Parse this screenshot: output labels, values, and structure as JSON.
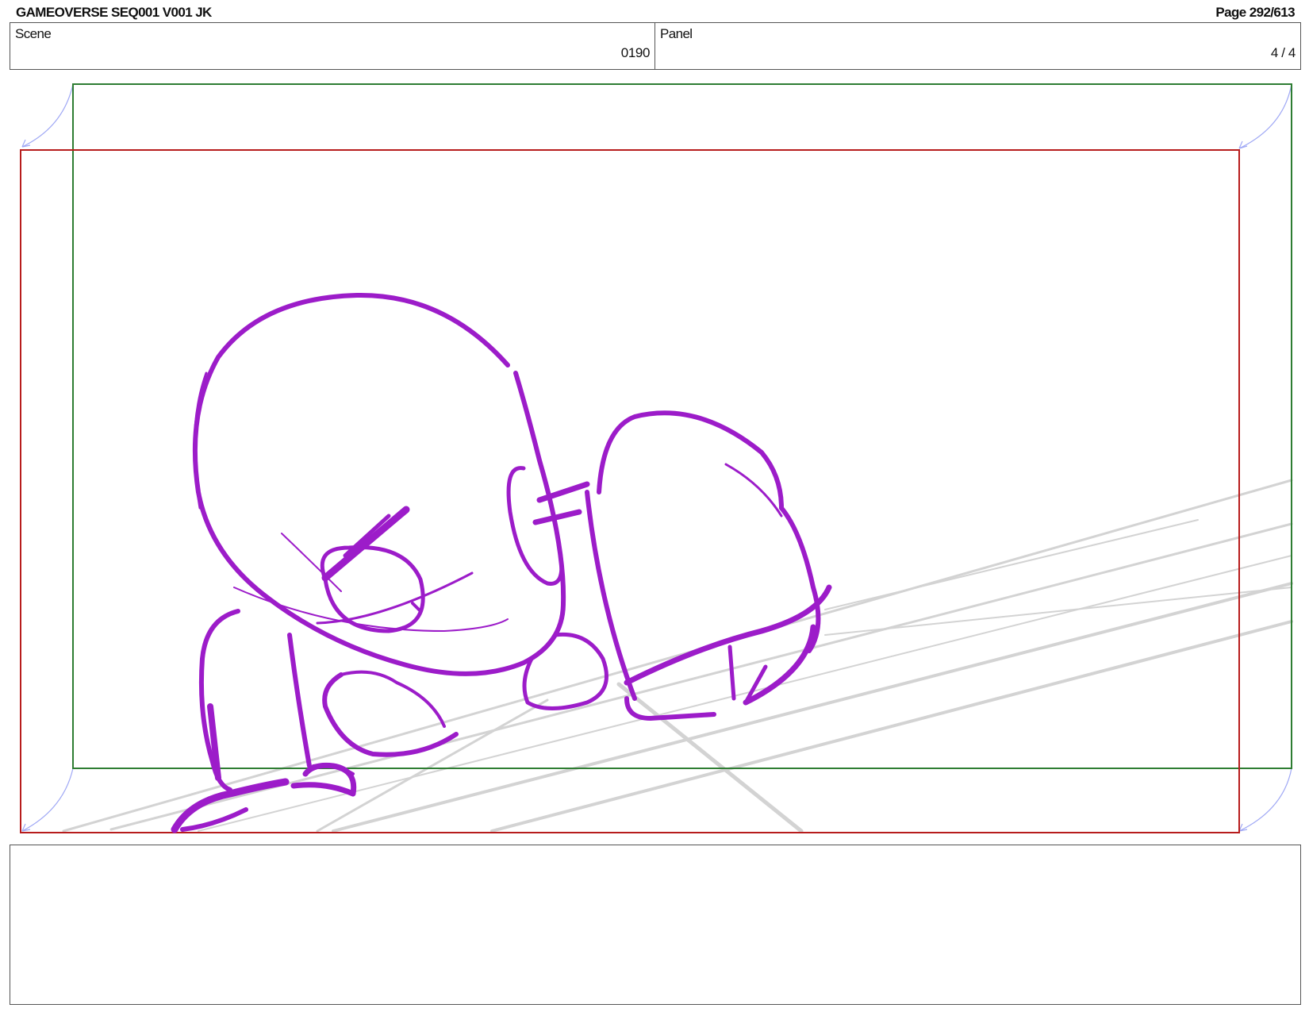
{
  "header": {
    "title": "GAMEOVERSE SEQ001 V001 JK",
    "page": "Page 292/613"
  },
  "info": {
    "scene_label": "Scene",
    "scene_value": "0190",
    "panel_label": "Panel",
    "panel_value": "4 / 4"
  },
  "panel": {
    "frame_colors": {
      "camera_start": "#2e7d32",
      "camera_end": "#b71c1c",
      "move_arrows": "#9fa8f5",
      "sketch": "#9c1cc9",
      "guides": "#d3d3d3"
    }
  },
  "notes": {
    "text": ""
  }
}
